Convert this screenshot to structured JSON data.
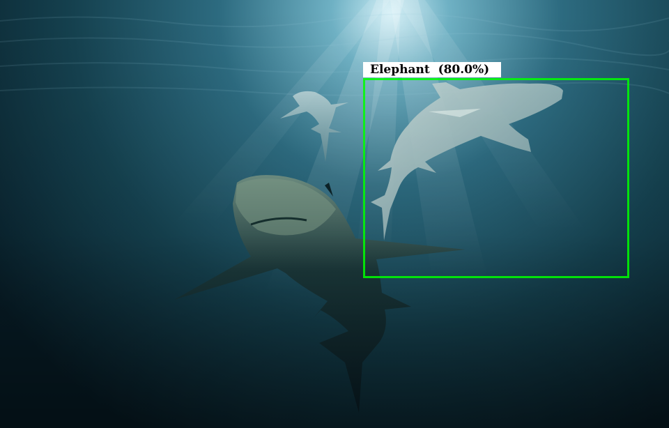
{
  "image": {
    "subject": "sharks-underwater",
    "water_color": "#0b2633",
    "light_color": "#bfe6f2"
  },
  "detections": [
    {
      "label": "Elephant",
      "score_text": "(80.0%)",
      "box_color": "#00ff00",
      "label_bg": "#ffffff"
    }
  ]
}
